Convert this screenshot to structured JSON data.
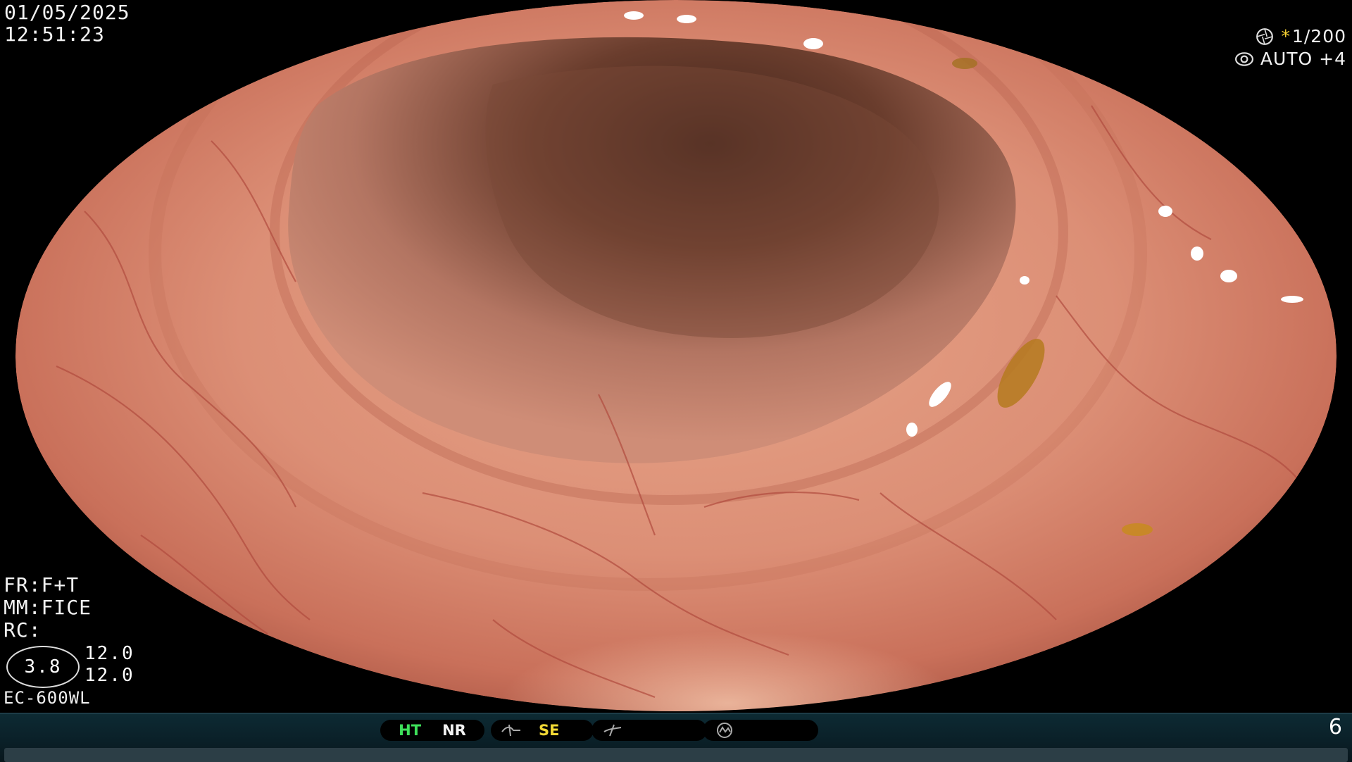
{
  "datetime": {
    "date": "01/05/2025",
    "time": "12:51:23"
  },
  "shutter": {
    "speed": "1/200",
    "exposure": "AUTO +4",
    "speed_icon": "aperture-icon",
    "exposure_icon": "iris-icon"
  },
  "info": {
    "fr": "FR:F+T",
    "mm": "MM:FICE",
    "rc": "RC:"
  },
  "fov": {
    "badge": "3.8",
    "value_top": "12.0",
    "value_bottom": "12.0"
  },
  "scope_model": "EC-600WL",
  "status_bar": {
    "ht": "HT",
    "nr": "NR",
    "se": "SE",
    "icons": [
      "structure-enhance-icon",
      "color-enhance-icon",
      "anti-glare-icon"
    ],
    "page": "6"
  },
  "colors": {
    "tissue": "#d98a72",
    "lumen": "#4a2a1f",
    "osd_yellow": "#f1d835",
    "osd_green": "#3ee05a",
    "bar": "#0d2a33"
  }
}
